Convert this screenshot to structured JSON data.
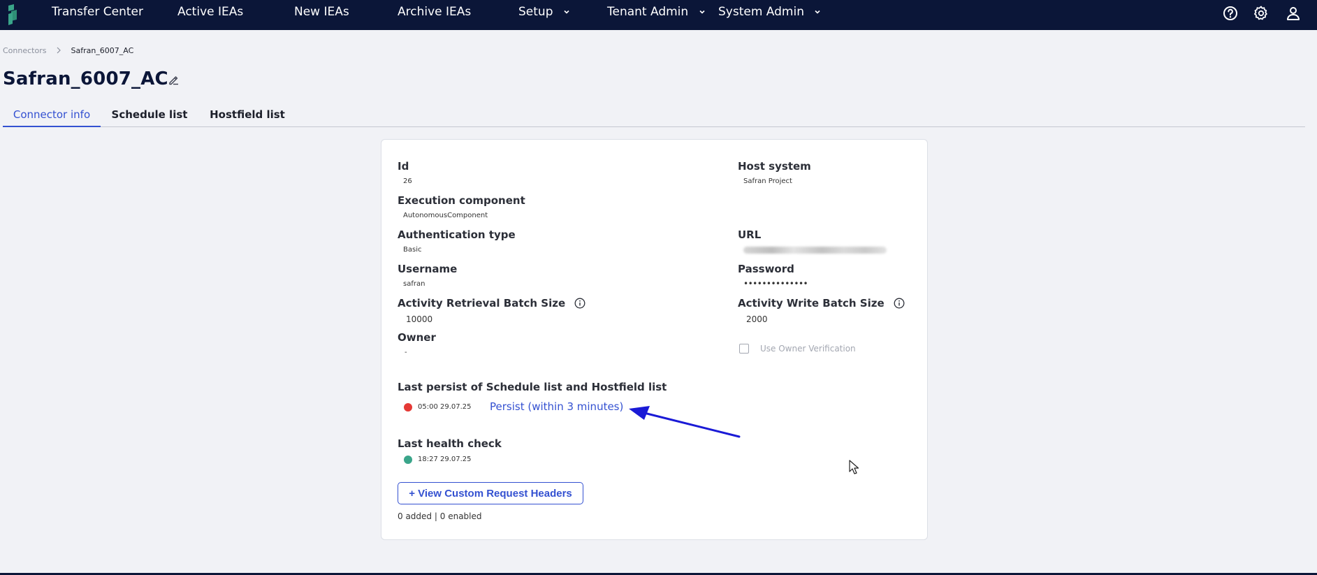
{
  "nav": {
    "items": [
      {
        "label": "Transfer Center"
      },
      {
        "label": "Active IEAs"
      },
      {
        "label": "New IEAs"
      },
      {
        "label": "Archive IEAs"
      },
      {
        "label": "Setup"
      },
      {
        "label": "Tenant Admin"
      },
      {
        "label": "System Admin"
      }
    ],
    "icons": [
      "help-icon",
      "gear-icon",
      "user-icon"
    ]
  },
  "breadcrumb": {
    "parent": "Connectors",
    "current": "Safran_6007_AC"
  },
  "page": {
    "title": "Safran_6007_AC"
  },
  "tabs": [
    {
      "label": "Connector info",
      "active": true
    },
    {
      "label": "Schedule list",
      "active": false
    },
    {
      "label": "Hostfield list",
      "active": false
    }
  ],
  "connector": {
    "id": {
      "label": "Id",
      "value": "26"
    },
    "host_system": {
      "label": "Host system",
      "value": "Safran Project"
    },
    "execution_component": {
      "label": "Execution component",
      "value": "AutonomousComponent"
    },
    "authentication_type": {
      "label": "Authentication type",
      "value": "Basic"
    },
    "url": {
      "label": "URL"
    },
    "username": {
      "label": "Username",
      "value": "safran"
    },
    "password": {
      "label": "Password",
      "value": "••••••••••••••"
    },
    "retrieval_batch": {
      "label": "Activity Retrieval Batch Size",
      "value": "10000"
    },
    "write_batch": {
      "label": "Activity Write Batch Size",
      "value": "2000"
    },
    "owner": {
      "label": "Owner",
      "value": "-"
    },
    "owner_verification": {
      "label": "Use Owner Verification",
      "checked": false
    },
    "last_persist": {
      "label": "Last persist of Schedule list and Hostfield list",
      "timestamp": "05:00 29.07.25",
      "status_color": "#e53935",
      "action_label": "Persist (within 3 minutes)"
    },
    "last_health": {
      "label": "Last health check",
      "timestamp": "18:27 29.07.25",
      "status_color": "#3aa58a"
    },
    "custom_headers": {
      "button_label": "+ View Custom Request Headers",
      "added": "0 added",
      "enabled": "0 enabled",
      "separator": "|"
    }
  },
  "colors": {
    "nav_bg": "#0b1638",
    "accent": "#3451d1",
    "annotation_arrow": "#1a1ad6"
  }
}
